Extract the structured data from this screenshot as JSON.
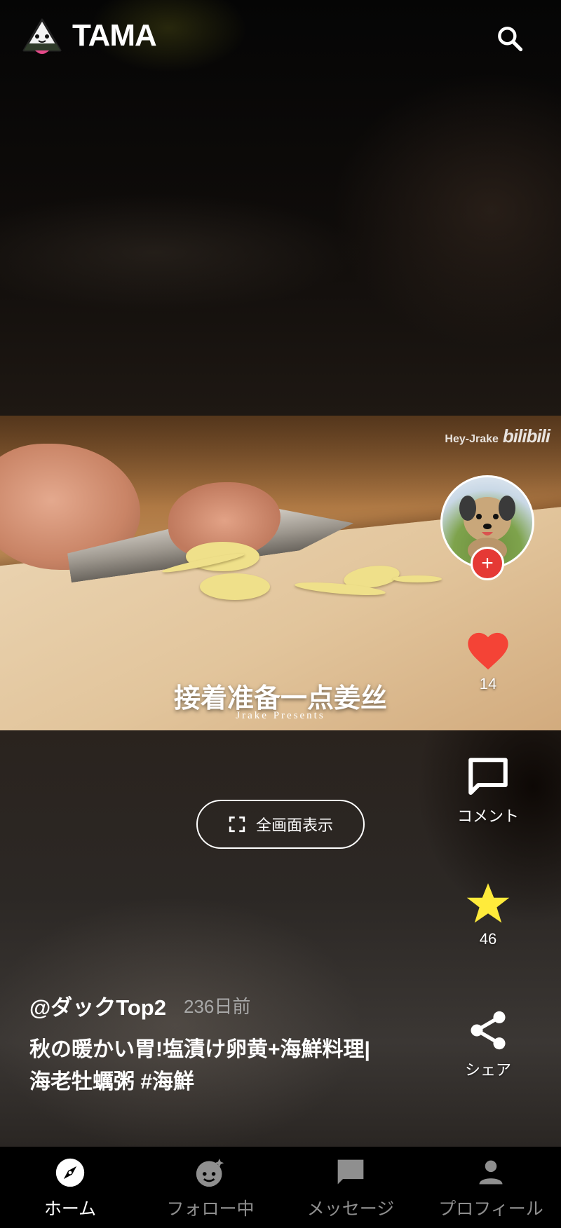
{
  "header": {
    "app_title": "TAMA"
  },
  "video": {
    "watermark_user": "Hey-Jrake",
    "watermark_brand": "bilibili",
    "subtitle": "接着准备一点姜丝",
    "credit": "Jrake Presents"
  },
  "rail": {
    "follow_symbol": "+",
    "like_count": "14",
    "comment_label": "コメント",
    "favorite_count": "46",
    "share_label": "シェア"
  },
  "fullscreen": {
    "label": "全画面表示"
  },
  "post": {
    "author": "@ダックTop2",
    "age": "236日前",
    "caption_line1": "秋の暖かい胃!塩漬け卵黄+海鮮料理|",
    "caption_line2": "海老牡蠣粥 #海鮮"
  },
  "nav": {
    "items": [
      {
        "label": "ホーム",
        "icon": "compass-icon",
        "active": true
      },
      {
        "label": "フォロー中",
        "icon": "following-face-icon",
        "active": false
      },
      {
        "label": "メッセージ",
        "icon": "message-icon",
        "active": false
      },
      {
        "label": "プロフィール",
        "icon": "person-icon",
        "active": false
      }
    ]
  },
  "colors": {
    "like": "#f44336",
    "favorite": "#ffeb3b",
    "follow": "#e53935"
  }
}
